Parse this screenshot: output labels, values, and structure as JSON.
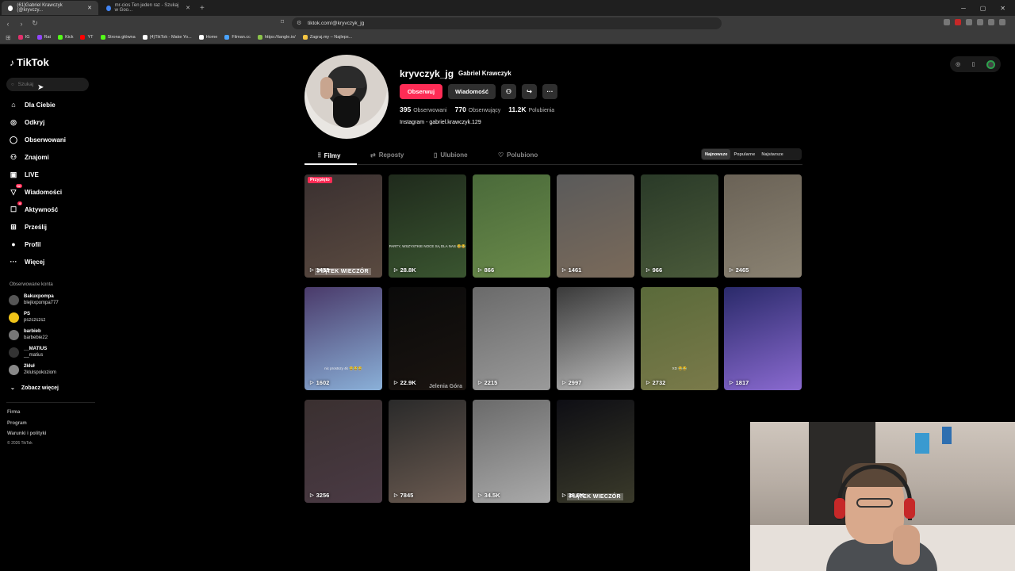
{
  "browser": {
    "tabs": [
      {
        "label": "(61)Gabriel Krawczyk (@kryvczy...",
        "active": true
      },
      {
        "label": "mr-cios Ten jeden raz - Szukaj w Goo...",
        "active": false
      }
    ],
    "url": "tiktok.com/@kryvczyk_jg",
    "bookmarks": [
      {
        "label": "IG",
        "color": "#e1306c"
      },
      {
        "label": "Rat",
        "color": "#9146ff"
      },
      {
        "label": "Kick",
        "color": "#53fc18"
      },
      {
        "label": "YT",
        "color": "#ff0000"
      },
      {
        "label": "Strona główna",
        "color": "#53fc18"
      },
      {
        "label": "(4)TikTok - Make Yo...",
        "color": "#ffffff"
      },
      {
        "label": "Home",
        "color": "#ffffff"
      },
      {
        "label": "Filman.cc",
        "color": "#4aa3ff"
      },
      {
        "label": "https://tangle.io/",
        "color": "#8bc34a"
      },
      {
        "label": "Zagraj.my – Najleps...",
        "color": "#f5c542"
      }
    ]
  },
  "sidebar": {
    "logo": "TikTok",
    "search_placeholder": "Szukaj",
    "nav": [
      {
        "label": "Dla Ciebie",
        "icon": "home-icon",
        "glyph": "⌂"
      },
      {
        "label": "Odkryj",
        "icon": "compass-icon",
        "glyph": "◎"
      },
      {
        "label": "Obserwowani",
        "icon": "following-icon",
        "glyph": "◯"
      },
      {
        "label": "Znajomi",
        "icon": "friends-icon",
        "glyph": "⚇"
      },
      {
        "label": "LIVE",
        "icon": "live-icon",
        "glyph": "▣"
      },
      {
        "label": "Wiadomości",
        "icon": "messages-icon",
        "glyph": "▽",
        "badge": "32"
      },
      {
        "label": "Aktywność",
        "icon": "activity-icon",
        "glyph": "☐",
        "badge": "4"
      },
      {
        "label": "Prześlij",
        "icon": "upload-icon",
        "glyph": "⊞"
      },
      {
        "label": "Profil",
        "icon": "profile-icon",
        "glyph": "●"
      },
      {
        "label": "Więcej",
        "icon": "more-icon",
        "glyph": "···"
      }
    ],
    "followed_title": "Obserwowane konta",
    "accounts": [
      {
        "name": "Bakuxpompa",
        "handle": "blejkxpompa777"
      },
      {
        "name": "PS",
        "handle": "pszszszsz"
      },
      {
        "name": "barbieb",
        "handle": "barbebie22"
      },
      {
        "name": "__MATIUS",
        "handle": "__matius"
      },
      {
        "name": "2kłuł",
        "handle": "2klulspokoziom"
      }
    ],
    "see_more": "Zobacz więcej",
    "footer": [
      "Firma",
      "Program",
      "Warunki i polityki"
    ],
    "copyright": "© 2026 TikTok"
  },
  "profile": {
    "username": "kryvczyk_jg",
    "display_name": "Gabriel Krawczyk",
    "follow_label": "Obserwuj",
    "message_label": "Wiadomość",
    "stats": [
      {
        "value": "395",
        "label": "Obserwowani"
      },
      {
        "value": "770",
        "label": "Obserwujący"
      },
      {
        "value": "11.2K",
        "label": "Polubienia"
      }
    ],
    "bio": "Instagram - gabriel.krawczyk.129"
  },
  "tabs": [
    "Filmy",
    "Reposty",
    "Ulubione",
    "Polubiono"
  ],
  "sort": [
    "Najnowsze",
    "Popularne",
    "Najstarsze"
  ],
  "videos": [
    {
      "count": "1458",
      "colors": [
        "#3a3030",
        "#5a4a40"
      ],
      "pinned": "Przypięto",
      "overlay": "PIĄTEK WIECZÓR"
    },
    {
      "count": "28.8K",
      "colors": [
        "#1f2a1c",
        "#3a5530"
      ],
      "caption": "PARTY, WSZYSTKIE NOCE SĄ DLA NAS 😂😂"
    },
    {
      "count": "866",
      "colors": [
        "#4a6a3a",
        "#6a8a4a"
      ]
    },
    {
      "count": "1461",
      "colors": [
        "#5a5a5a",
        "#7a6a5a"
      ]
    },
    {
      "count": "966",
      "colors": [
        "#2a3a28",
        "#4a5a3a"
      ]
    },
    {
      "count": "2465",
      "colors": [
        "#6a6256",
        "#8a8272"
      ]
    },
    {
      "count": "1602",
      "colors": [
        "#4a3a6a",
        "#8ab0d8"
      ],
      "caption": "nic prostszy 4k 😂😂😂"
    },
    {
      "count": "22.9K",
      "colors": [
        "#0a0a0a",
        "#1a1410"
      ],
      "location": "Jelenia Góra"
    },
    {
      "count": "2215",
      "colors": [
        "#6a6a6a",
        "#9a9a9a"
      ]
    },
    {
      "count": "2997",
      "colors": [
        "#3a3a3a",
        "#bababa"
      ]
    },
    {
      "count": "2732",
      "colors": [
        "#5a6a3a",
        "#7a7a4a"
      ],
      "caption": "XD 😂😂"
    },
    {
      "count": "1817",
      "colors": [
        "#2a2a6a",
        "#8a6ad0"
      ]
    },
    {
      "count": "3256",
      "colors": [
        "#3a3030",
        "#4a3a44"
      ]
    },
    {
      "count": "7845",
      "colors": [
        "#2a2a2a",
        "#6a5a50"
      ]
    },
    {
      "count": "34.5K",
      "colors": [
        "#6a6a6a",
        "#aaaaaa"
      ]
    },
    {
      "count": "38.5K",
      "colors": [
        "#0e0e14",
        "#3a3a2a"
      ],
      "overlay": "PIĄTEK WIECZÓR"
    }
  ]
}
